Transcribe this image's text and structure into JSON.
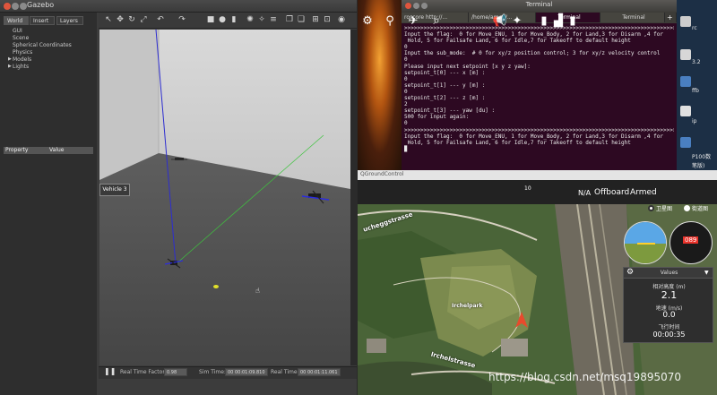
{
  "gazebo": {
    "title": "Gazebo",
    "tabs": [
      "World",
      "Insert",
      "Layers"
    ],
    "tree": [
      "GUI",
      "Scene",
      "Spherical Coordinates",
      "Physics",
      "Models",
      "Lights"
    ],
    "property_col": "Property",
    "value_col": "Value",
    "bottom": {
      "rtf_label": "Real Time Factor:",
      "rtf_value": "0.98",
      "sim_label": "Sim Time:",
      "sim_value": "00 00:01:09.810",
      "real_label": "Real Time:",
      "real_value": "00 00:01:11.061"
    }
  },
  "terminal": {
    "title": "Terminal",
    "tabs": [
      "roscore http://...",
      "/home/amov/...",
      "Terminal",
      "Terminal"
    ],
    "lines": [
      ">>>>>>>>>>>>>>>>>>>>>>>>>>>>>>>>>>>>>>>>>>>>>>>>>>>>>>>>>>>>>>>>>>>>>>>>>>>>>>>>>>>>>>>>>>>>",
      "Input the flag:  0 for Move_ENU, 1 for Move_Body, 2 for Land,3 for Disarm ,4 for",
      " Hold, 5 for Failsafe Land, 6 for Idle,7 for Takeoff to default height",
      "0",
      "Input the sub_mode:  # 0 for xy/z position control; 3 for xy/z velocity control",
      "0",
      "Please input next setpoint [x y z yaw]:",
      "setpoint_t[0] --- x [m] :",
      "0",
      "setpoint_t[1] --- y [m] :",
      "0",
      "setpoint_t[2] --- z [m] :",
      "2",
      "setpoint_t[3] --- yaw [du] :",
      "500 for input again:",
      "0",
      ">>>>>>>>>>>>>>>>>>>>>>>>>>>>>>>>>>>>>>>>>>>>>>>>>>>>>>>>>>>>>>>>>>>>>>>>>>>>>>>>>>>>>>>>>>>>",
      "Input the flag:  0 for Move_ENU, 1 for Move_Body, 2 for Land,3 for Disarm ,4 for",
      " Hold, 5 for Failsafe Land, 6 for Idle,7 for Takeoff to default height",
      "▉"
    ]
  },
  "desktop": {
    "right_labels": [
      "rc",
      "3.2",
      "ffb",
      "ip",
      "P100数",
      "笔版)"
    ]
  },
  "qgc": {
    "title": "QGroundControl",
    "vehicle": "Vehicle 3",
    "satellite_count": "10",
    "rssi_label": "N/A",
    "flight_mode": "Offboard",
    "arm_state": "Armed",
    "map_labels": [
      {
        "text": "ucheggstrasse"
      },
      {
        "text": "Irchelpark"
      },
      {
        "text": "Irchelstrasse"
      }
    ],
    "map_mode": [
      "卫星图",
      "街道图"
    ],
    "values_panel": {
      "header": "Values",
      "alt_label": "相对高度 (m)",
      "alt_value": "2.1",
      "speed_label": "地速 (m/s)",
      "speed_value": "0.0",
      "time_label": "飞行时间",
      "time_value": "00:00:35"
    },
    "compass_heading": "089"
  },
  "watermark": "https://blog.csdn.net/msq19895070"
}
